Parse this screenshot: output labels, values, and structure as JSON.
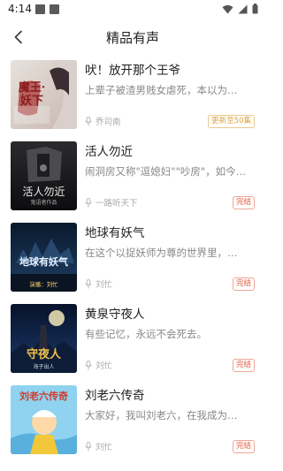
{
  "status": {
    "time": "4:14"
  },
  "header": {
    "title": "精品有声"
  },
  "books": [
    {
      "title": "吠！放开那个王爷",
      "desc": "上辈子被渣男贱女虐死，本以为…",
      "author": "乔司南",
      "badge": "更新至50集",
      "badge_type": "update"
    },
    {
      "title": "活人勿近",
      "desc": "闹洞房又称\"逗媳妇\"\"吵房\"，如今…",
      "author": "一路听天下",
      "badge": "完结",
      "badge_type": "done"
    },
    {
      "title": "地球有妖气",
      "desc": "在这个以捉妖师为尊的世界里，…",
      "author": "刘忙",
      "badge": "完结",
      "badge_type": "done"
    },
    {
      "title": "黄泉守夜人",
      "desc": "有些记忆，永远不会死去。",
      "author": "刘忙",
      "badge": "完结",
      "badge_type": "done"
    },
    {
      "title": "刘老六传奇",
      "desc": "大家好，我叫刘老六，在我成为…",
      "author": "刘忙",
      "badge": "完结",
      "badge_type": "done"
    }
  ],
  "covers": [
    {
      "text": "魔王·妖下"
    },
    {
      "text": "活人勿近",
      "sub": "鬼语者作品"
    },
    {
      "text": "地球有妖气",
      "sub": "演播：刘忙"
    },
    {
      "text": "守夜人",
      "sub": "海子出人"
    },
    {
      "text": "刘老六传奇"
    }
  ]
}
